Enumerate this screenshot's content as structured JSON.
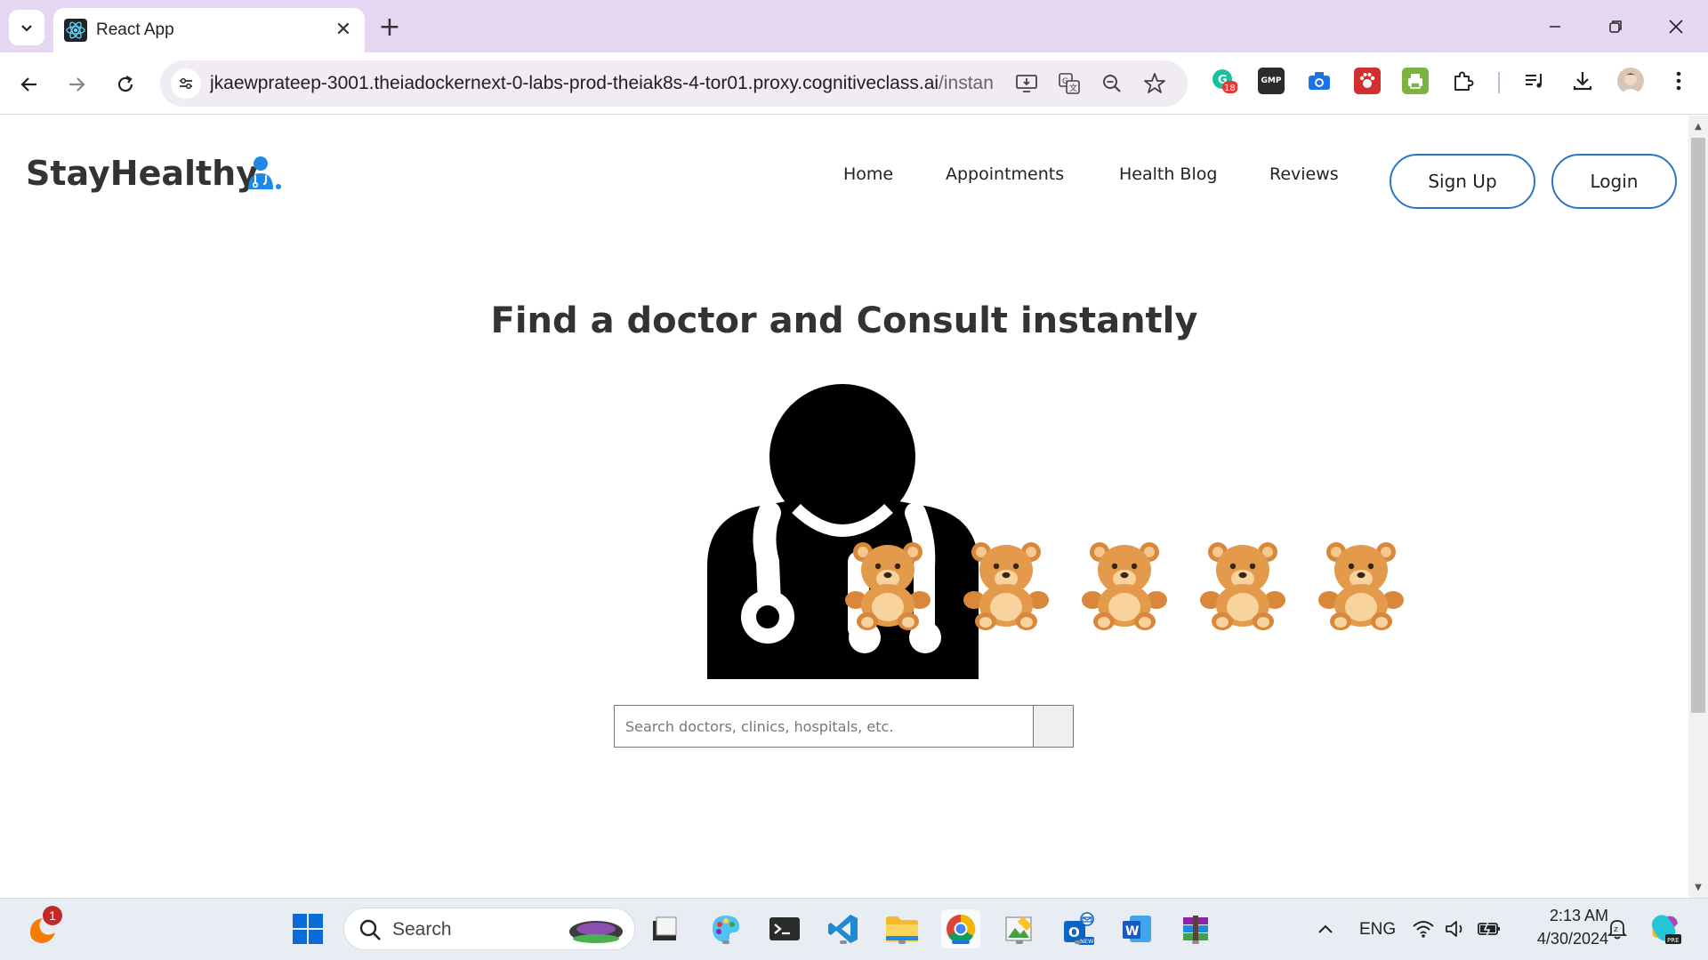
{
  "browser": {
    "tab_title": "React App",
    "url_host": "jkaewprateep-3001.theiadockernext-0-labs-prod-theiak8s-4-tor01.proxy.cognitiveclass.ai",
    "url_path": "/instant",
    "extension_badge": "18",
    "gmp_label": "GMP"
  },
  "site": {
    "logo_text": "StayHealthy",
    "nav": {
      "home": "Home",
      "appointments": "Appointments",
      "health_blog": "Health Blog",
      "reviews": "Reviews"
    },
    "signup_label": "Sign Up",
    "login_label": "Login",
    "hero_title": "Find a doctor and Consult instantly",
    "search_placeholder": "Search doctors, clinics, hospitals, etc.",
    "bear_count": 5
  },
  "taskbar": {
    "search_label": "Search",
    "notification_badge": "1",
    "language": "ENG",
    "time": "2:13 AM",
    "date": "4/30/2024"
  },
  "colors": {
    "tabbar": "#e5d6f1",
    "accent_blue": "#2776c6",
    "logo_icon_blue": "#1e88e5",
    "bear": "#e39a4b"
  }
}
